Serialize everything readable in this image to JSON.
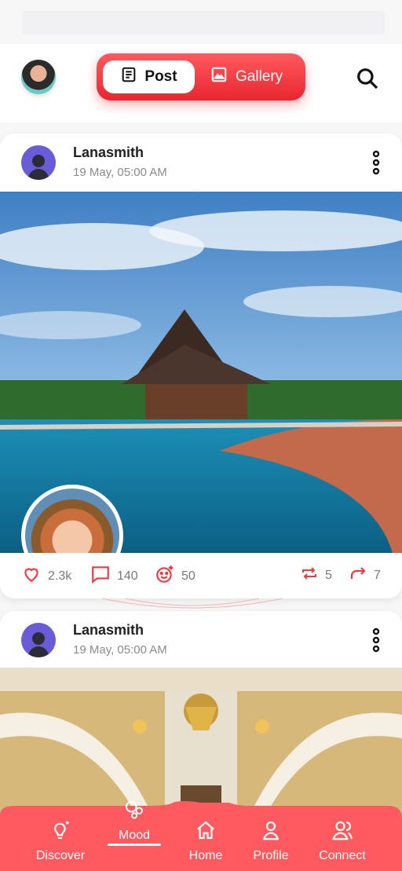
{
  "header": {
    "tabs": [
      {
        "label": "Post",
        "icon": "document-icon",
        "active": true
      },
      {
        "label": "Gallery",
        "icon": "image-icon",
        "active": false
      }
    ],
    "search_icon": "search-icon"
  },
  "posts": [
    {
      "user": "Lanasmith",
      "date": "19 May, 05:00 AM",
      "image": "tropical-resort-pool-photo",
      "actions": {
        "likes": "2.3k",
        "comments": "140",
        "reactions": "50",
        "reposts": "5",
        "shares": "7"
      }
    },
    {
      "user": "Lanasmith",
      "date": "19 May, 05:00 AM",
      "image": "grand-staircase-chandelier-photo"
    }
  ],
  "nav": {
    "items": [
      {
        "label": "Discover",
        "icon": "bulb-icon"
      },
      {
        "label": "Mood",
        "icon": "bubbles-icon",
        "active": true
      },
      {
        "label": "Home",
        "icon": "home-icon"
      },
      {
        "label": "Profile",
        "icon": "profile-icon"
      },
      {
        "label": "Connect",
        "icon": "users-icon"
      }
    ]
  },
  "colors": {
    "accent": "#ee3a42",
    "nav_bg": "#ff5a5f",
    "text_dark": "#222222",
    "text_muted": "#8b8b8b"
  }
}
